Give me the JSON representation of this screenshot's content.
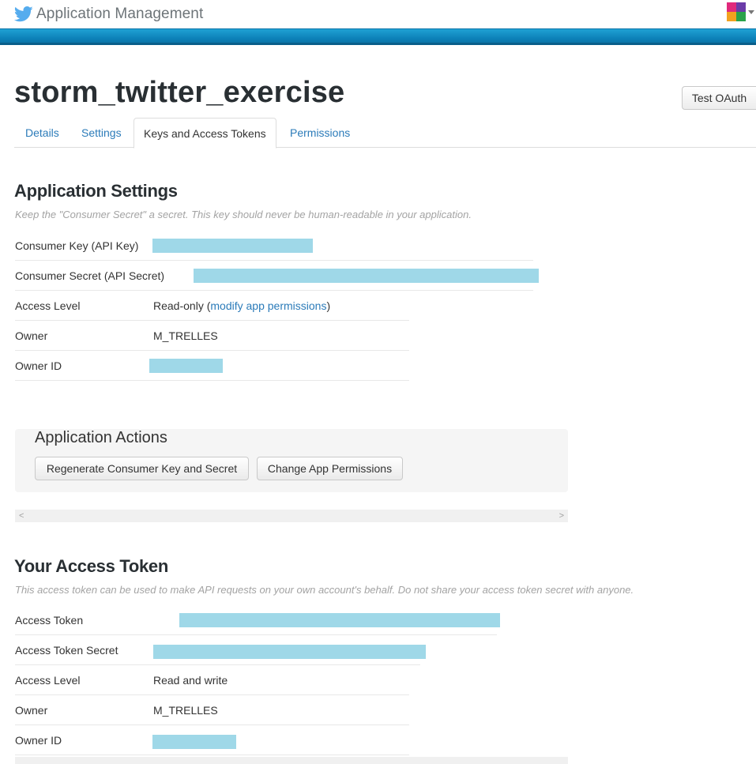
{
  "topbar": {
    "title": "Application Management"
  },
  "app": {
    "name": "storm_twitter_exercise",
    "test_oauth_label": "Test OAuth"
  },
  "tabs": [
    {
      "label": "Details"
    },
    {
      "label": "Settings"
    },
    {
      "label": "Keys and Access Tokens"
    },
    {
      "label": "Permissions"
    }
  ],
  "app_settings": {
    "title": "Application Settings",
    "hint": "Keep the \"Consumer Secret\" a secret. This key should never be human-readable in your application.",
    "consumer_key_label": "Consumer Key (API Key)",
    "consumer_secret_label": "Consumer Secret (API Secret)",
    "access_level_label": "Access Level",
    "access_level_value": "Read-only",
    "access_level_open": " (",
    "access_level_link": "modify app permissions",
    "access_level_close": ")",
    "owner_label": "Owner",
    "owner_value": "M_TRELLES",
    "owner_id_label": "Owner ID"
  },
  "app_actions": {
    "title": "Application Actions",
    "regenerate_label": "Regenerate Consumer Key and Secret",
    "change_permissions_label": "Change App Permissions"
  },
  "access_token": {
    "title": "Your Access Token",
    "hint": "This access token can be used to make API requests on your own account's behalf. Do not share your access token secret with anyone.",
    "token_label": "Access Token",
    "token_secret_label": "Access Token Secret",
    "access_level_label": "Access Level",
    "access_level_value": "Read and write",
    "owner_label": "Owner",
    "owner_value": "M_TRELLES",
    "owner_id_label": "Owner ID"
  },
  "colors": {
    "accent": "#2b7bb9",
    "band": "#0c80b7",
    "redaction": "#9fd8e8"
  },
  "icons": {
    "brand": "twitter-bird-icon",
    "dropdown": "caret-down-icon",
    "scroll_left": "chevron-left-icon",
    "scroll_right": "chevron-right-icon"
  }
}
